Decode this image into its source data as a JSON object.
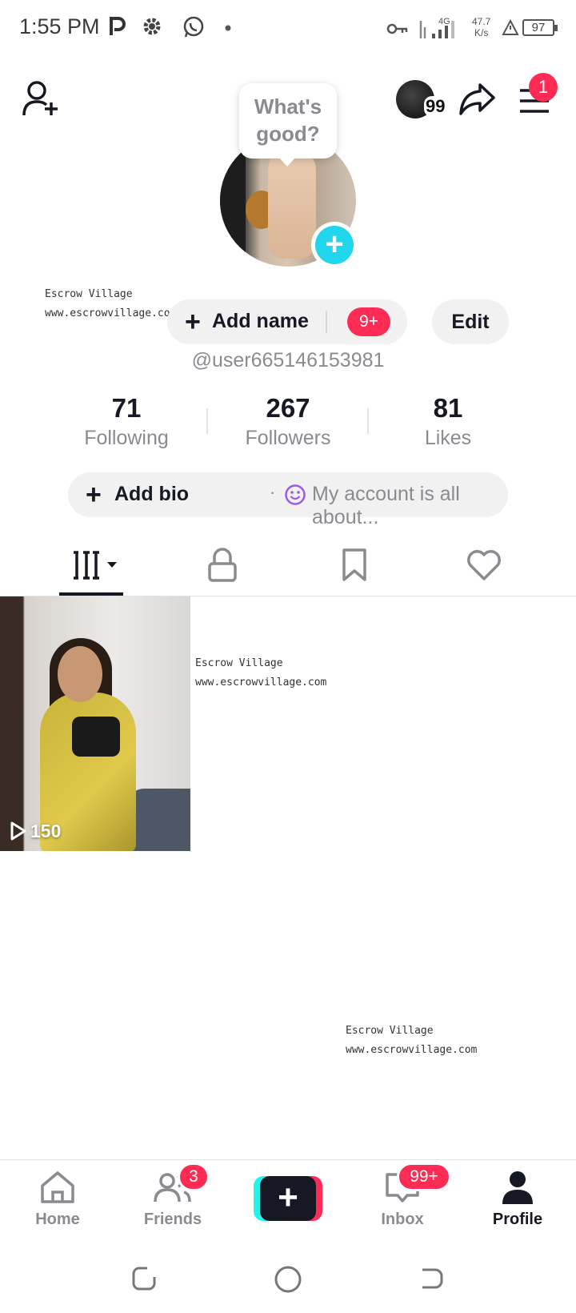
{
  "status_bar": {
    "time": "1:55 PM",
    "network_speed": "47.7",
    "network_unit": "K/s",
    "network_type": "4G",
    "battery": "97",
    "icons": [
      "p-app-icon",
      "gear-icon",
      "whatsapp-icon",
      "dot-icon",
      "key-icon",
      "signal-icon",
      "alert-icon"
    ]
  },
  "header": {
    "add_friend_icon": "add-user-icon",
    "mini_avatar_count": "99",
    "share_icon": "share-icon",
    "menu_icon": "hamburger-icon",
    "menu_badge": "1"
  },
  "profile": {
    "bubble_text_line1": "What's",
    "bubble_text_line2": "good?",
    "add_name_label": "Add name",
    "add_name_badge": "9+",
    "edit_label": "Edit",
    "handle": "@user665146153981",
    "stats": [
      {
        "value": "71",
        "label": "Following"
      },
      {
        "value": "267",
        "label": "Followers"
      },
      {
        "value": "81",
        "label": "Likes"
      }
    ],
    "add_bio_label": "Add bio",
    "bio_separator": "·",
    "bio_hint": "My account is all about..."
  },
  "tabs": [
    {
      "name": "videos-grid",
      "icon": "grid-icon",
      "active": true
    },
    {
      "name": "private",
      "icon": "lock-icon",
      "active": false
    },
    {
      "name": "saved",
      "icon": "bookmark-icon",
      "active": false
    },
    {
      "name": "liked",
      "icon": "heart-icon",
      "active": false
    }
  ],
  "videos": [
    {
      "views": "150"
    }
  ],
  "watermarks": [
    {
      "line1": "Escrow Village",
      "line2": "www.escrowvillage.com"
    },
    {
      "line1": "Escrow Village",
      "line2": "www.escrowvillage.com"
    },
    {
      "line1": "Escrow Village",
      "line2": "www.escrowvillage.com"
    }
  ],
  "bottom_nav": {
    "home": "Home",
    "friends": "Friends",
    "friends_badge": "3",
    "inbox": "Inbox",
    "inbox_badge": "99+",
    "profile": "Profile"
  },
  "colors": {
    "accent_red": "#fe2c55",
    "accent_cyan": "#20d5ec",
    "text_primary": "#161823",
    "text_secondary": "#8a8b91"
  }
}
